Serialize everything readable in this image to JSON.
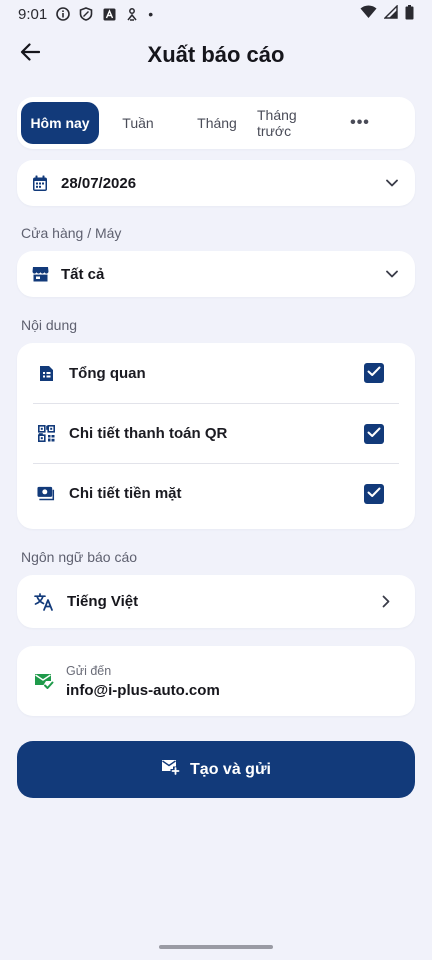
{
  "status_bar": {
    "time": "9:01",
    "dot": "•",
    "icons_left": [
      "info-icon",
      "shield-icon",
      "a-letter-icon",
      "download-person-icon"
    ],
    "icons_right": [
      "wifi-icon",
      "signal-icon",
      "battery-icon"
    ]
  },
  "header": {
    "title": "Xuất báo cáo",
    "back_icon": "arrow-left-icon"
  },
  "period_tabs": {
    "items": [
      "Hôm nay",
      "Tuần",
      "Tháng",
      "Tháng trước"
    ],
    "more": "•••",
    "active_index": 0
  },
  "date_field": {
    "value": "28/07/2026",
    "icon": "calendar-icon"
  },
  "store": {
    "label": "Cửa hàng / Máy",
    "value": "Tất cả",
    "icon": "store-icon"
  },
  "content": {
    "label": "Nội dung",
    "items": [
      {
        "label": "Tổng quan",
        "icon": "document-icon",
        "checked": true
      },
      {
        "label": "Chi tiết thanh toán QR",
        "icon": "qr-code-icon",
        "checked": true
      },
      {
        "label": "Chi tiết tiền mặt",
        "icon": "cash-icon",
        "checked": true
      }
    ]
  },
  "language": {
    "label": "Ngôn ngữ báo cáo",
    "value": "Tiếng Việt",
    "icon": "translate-icon"
  },
  "send_to": {
    "caption": "Gửi đến",
    "email": "info@i-plus-auto.com",
    "icon": "mail-check-icon"
  },
  "action": {
    "label": "Tạo và gửi",
    "icon": "mail-add-icon"
  },
  "colors": {
    "primary": "#123a7a",
    "background": "#f1f2fa",
    "card": "#ffffff",
    "success": "#1f9a4a"
  }
}
